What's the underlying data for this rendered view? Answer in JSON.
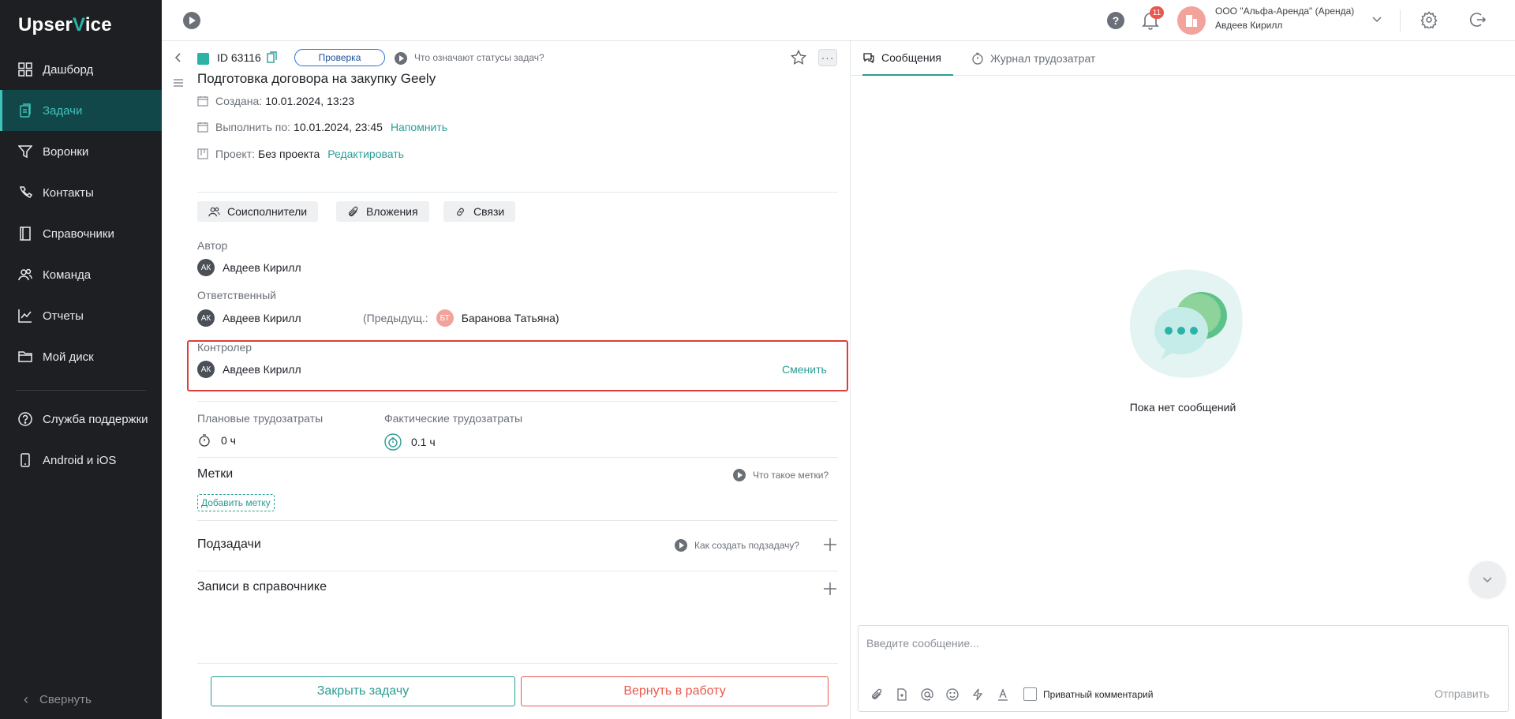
{
  "app": {
    "logo_main": "Upser",
    "logo_accent": "V",
    "logo_rest": "ice"
  },
  "sidebar": {
    "items": [
      {
        "label": "Дашборд",
        "icon": "dashboard-icon"
      },
      {
        "label": "Задачи",
        "icon": "tasks-icon",
        "active": true
      },
      {
        "label": "Воронки",
        "icon": "funnel-icon"
      },
      {
        "label": "Контакты",
        "icon": "contacts-icon"
      },
      {
        "label": "Справочники",
        "icon": "book-icon"
      },
      {
        "label": "Команда",
        "icon": "team-icon"
      },
      {
        "label": "Отчеты",
        "icon": "chart-icon"
      },
      {
        "label": "Мой диск",
        "icon": "folder-icon"
      }
    ],
    "secondary": [
      {
        "label": "Служба поддержки",
        "icon": "help-icon"
      },
      {
        "label": "Android и iOS",
        "icon": "phone-icon"
      }
    ],
    "collapse_label": "Свернуть"
  },
  "topbar": {
    "notifications_count": "11",
    "org_name": "ООО \"Альфа-Аренда\" (Аренда)",
    "user_name": "Авдеев Кирилл"
  },
  "task": {
    "id": "ID 63116",
    "status": "Проверка",
    "status_help": "Что означают статусы задач?",
    "title": "Подготовка договора на закупку Geely",
    "created_label": "Создана:",
    "created_value": "10.01.2024, 13:23",
    "due_label": "Выполнить по:",
    "due_value": "10.01.2024, 23:45",
    "remind_link": "Напомнить",
    "project_label": "Проект:",
    "project_value": "Без проекта",
    "edit_link": "Редактировать",
    "chips": {
      "coexecutors": "Соисполнители",
      "attachments": "Вложения",
      "links": "Связи"
    },
    "author_label": "Автор",
    "author": {
      "initials": "АК",
      "name": "Авдеев Кирилл"
    },
    "responsible_label": "Ответственный",
    "responsible": {
      "initials": "АК",
      "name": "Авдеев Кирилл"
    },
    "previous_label": "(Предыдущ.:",
    "previous": {
      "initials": "БТ",
      "name": "Баранова Татьяна)"
    },
    "controller_label": "Контролер",
    "controller": {
      "initials": "АК",
      "name": "Авдеев Кирилл"
    },
    "change_link": "Сменить",
    "planned_label": "Плановые трудозатраты",
    "planned_value": "0 ч",
    "actual_label": "Фактические трудозатраты",
    "actual_value": "0.1 ч",
    "tags_title": "Метки",
    "tags_help": "Что такое метки?",
    "add_tag": "Добавить метку",
    "subtasks_title": "Подзадачи",
    "subtasks_help": "Как создать подзадачу?",
    "records_title": "Записи в справочнике",
    "close_button": "Закрыть задачу",
    "return_button": "Вернуть в работу"
  },
  "messages": {
    "tab_messages": "Сообщения",
    "tab_worklog": "Журнал трудозатрат",
    "empty": "Пока нет сообщений",
    "input_placeholder": "Введите сообщение...",
    "private_label": "Приватный комментарий",
    "send_label": "Отправить"
  },
  "colors": {
    "accent": "#2a9d94",
    "sidebar_bg": "#1d1f23",
    "danger": "#e8584d",
    "highlight_border": "#d9403a"
  }
}
